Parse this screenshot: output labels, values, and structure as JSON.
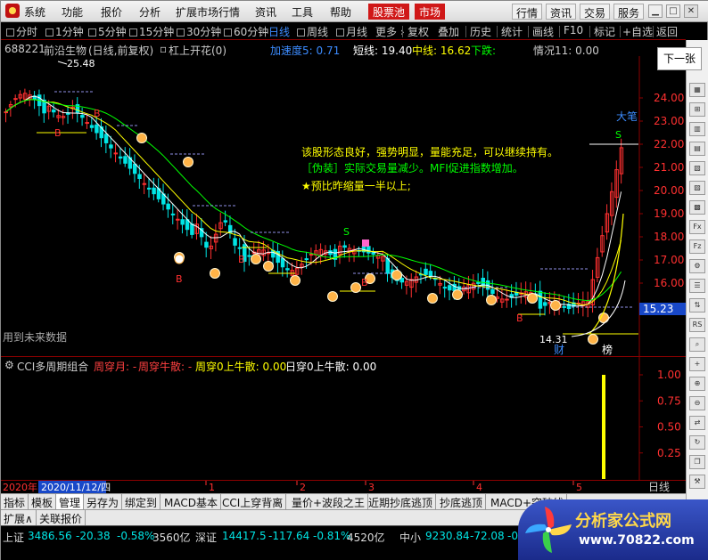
{
  "menu": {
    "items": [
      "系统",
      "功能",
      "报价",
      "分析",
      "扩展市场行情",
      "资讯",
      "工具",
      "帮助"
    ],
    "hot": [
      "股票池",
      "市场"
    ],
    "right_buttons": [
      "行情",
      "资讯",
      "交易",
      "服务"
    ]
  },
  "periods": {
    "items": [
      "分时",
      "1分钟",
      "5分钟",
      "15分钟",
      "30分钟",
      "60分钟",
      "日线",
      "周线",
      "月线",
      "更多"
    ],
    "active": "日线",
    "more_caret": "›",
    "tools": [
      "复权",
      "叠加",
      "历史",
      "统计",
      "画线",
      "F10",
      "标记",
      "+自选",
      "返回"
    ]
  },
  "next_page": "下一张",
  "stock": {
    "code": "688221",
    "name": "前沿生物",
    "mode": "(日线,前复权)",
    "pattern": "杠上开花(0)",
    "accel": "加速度5: 0.71",
    "short_line": "短线: 19.40",
    "mid_line": "中线: 16.62",
    "down": "下跌:",
    "situation": "情况11: 0.00"
  },
  "annotations": {
    "line1": "该股形态良好，强势明显，量能充足，可以继续持有。",
    "line2": "［伪装］实际交易量减少。MFI促进指数增加。",
    "line3": "★预比昨缩量一半以上;",
    "big_pen": "大笔",
    "high_label": "25.48",
    "low_label": "14.31",
    "future_text": "用到未来数据",
    "price_tag": "15.23",
    "finance_tag": "财",
    "rank_tag": "榜"
  },
  "price_axis": {
    "ticks": [
      "24.00",
      "23.00",
      "22.00",
      "21.00",
      "20.00",
      "19.00",
      "18.00",
      "17.00",
      "16.00",
      "15.00"
    ],
    "values": [
      24,
      23,
      22,
      21,
      20,
      19,
      18,
      17,
      16,
      15
    ]
  },
  "indicator": {
    "name": "CCI多周期组合",
    "a_label": "周穿月: -",
    "b_label": "周穿牛散: -",
    "c_label": "周穿0上牛散: 0.00",
    "d_label": "日穿0上牛散: 0.00",
    "ticks": [
      "1.00",
      "0.75",
      "0.50",
      "0.25"
    ]
  },
  "date_axis": {
    "year": "2020年",
    "cursor_date": "2020/11/12/四",
    "months": [
      "1",
      "2",
      "3",
      "4",
      "5"
    ],
    "period": "日线"
  },
  "tabs": {
    "row1": [
      "指标",
      "模板",
      "管理",
      "另存为",
      "绑定到",
      "MACD基本",
      "CCI上穿背离",
      "量价+波段之王",
      "近期抄底逃顶",
      "抄底逃顶",
      "MACD+突破线"
    ],
    "active": "管理",
    "row2": [
      "扩展∧",
      "关联报价"
    ]
  },
  "status": {
    "sh_name": "上证",
    "sh_value": "3486.56",
    "sh_change": "-20.38",
    "sh_pct": "-0.58%",
    "sh_amount": "3560亿",
    "sz_name": "深证",
    "sz_value": "14417.5",
    "sz_change": "-117.64",
    "sz_pct": "-0.81%",
    "sz_amount": "4520亿",
    "zx_name": "中小",
    "zx_value": "9230.84",
    "zx_change": "-72.08",
    "zx_pct": "-0."
  },
  "watermark": {
    "brand": "分析家公式网",
    "url": "www.70822.com"
  },
  "colors": {
    "up": "#ff3030",
    "down": "#00e5e5",
    "ma_white": "#ffffff",
    "ma_yellow": "#ffff00",
    "ma_green": "#00ff00",
    "grid": "#8b0000",
    "accent": "#3c8cff"
  }
}
